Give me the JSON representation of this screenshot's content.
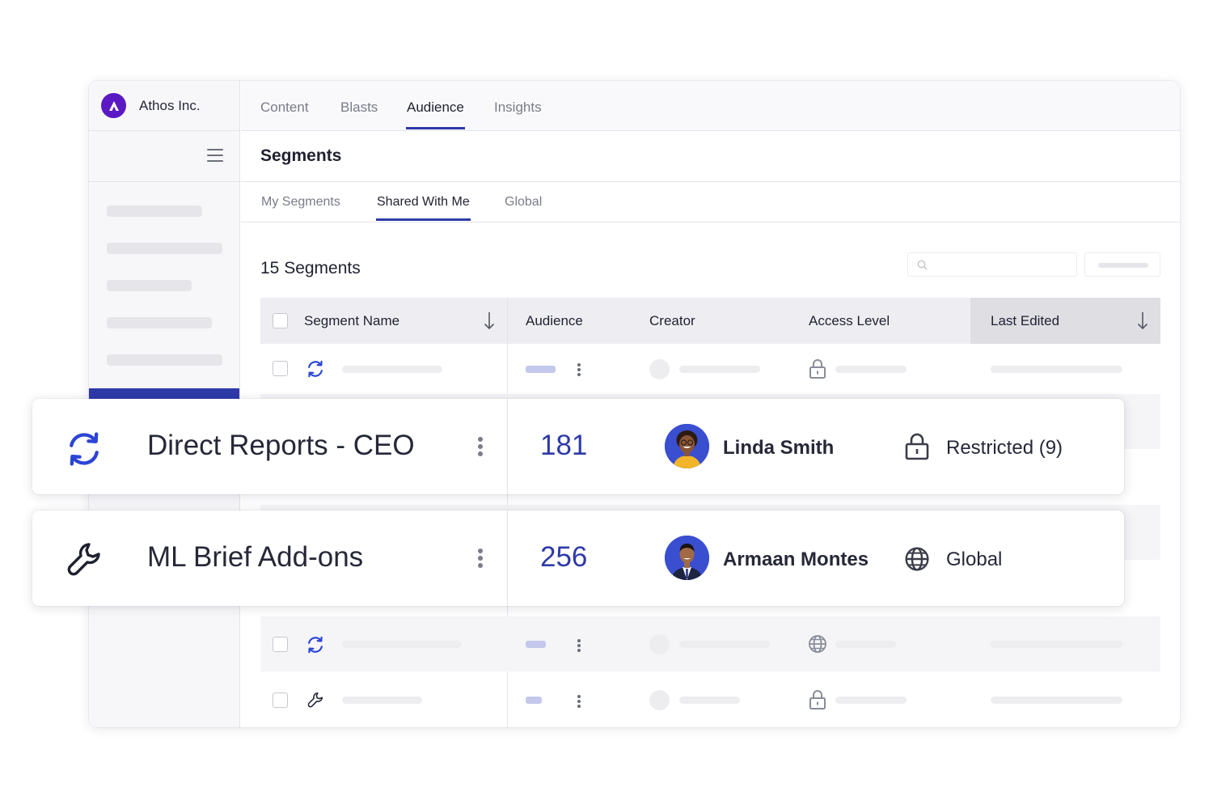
{
  "app": {
    "org_name": "Athos Inc.",
    "accent_color": "#2e3aa8",
    "logo_color": "#5b19c4"
  },
  "top_nav": {
    "tabs": [
      {
        "label": "Content",
        "active": false
      },
      {
        "label": "Blasts",
        "active": false
      },
      {
        "label": "Audience",
        "active": true
      },
      {
        "label": "Insights",
        "active": false
      }
    ]
  },
  "page": {
    "title": "Segments"
  },
  "sub_tabs": {
    "tabs": [
      {
        "label": "My Segments",
        "active": false
      },
      {
        "label": "Shared With Me",
        "active": true
      },
      {
        "label": "Global",
        "active": false
      }
    ]
  },
  "list": {
    "count_label": "15 Segments"
  },
  "table": {
    "columns": [
      {
        "label": "Segment Name",
        "sortable": true
      },
      {
        "label": "Audience"
      },
      {
        "label": "Creator"
      },
      {
        "label": "Access Level"
      },
      {
        "label": "Last Edited",
        "sortable": true,
        "sorted": "descending"
      }
    ],
    "placeholder_rows": [
      {
        "icon": "sync-icon",
        "access_icon": "lock-icon"
      },
      {
        "icon": "sync-icon",
        "access_icon": "globe-icon"
      },
      {
        "icon": "wrench-icon",
        "access_icon": "lock-icon"
      }
    ]
  },
  "highlighted_segments": [
    {
      "icon": "sync-icon",
      "name": "Direct Reports - CEO",
      "audience": "181",
      "creator": "Linda Smith",
      "access_icon": "lock-icon",
      "access_level": "Restricted (9)"
    },
    {
      "icon": "wrench-icon",
      "name": "ML Brief Add-ons",
      "audience": "256",
      "creator": "Armaan Montes",
      "access_icon": "globe-icon",
      "access_level": "Global"
    }
  ]
}
